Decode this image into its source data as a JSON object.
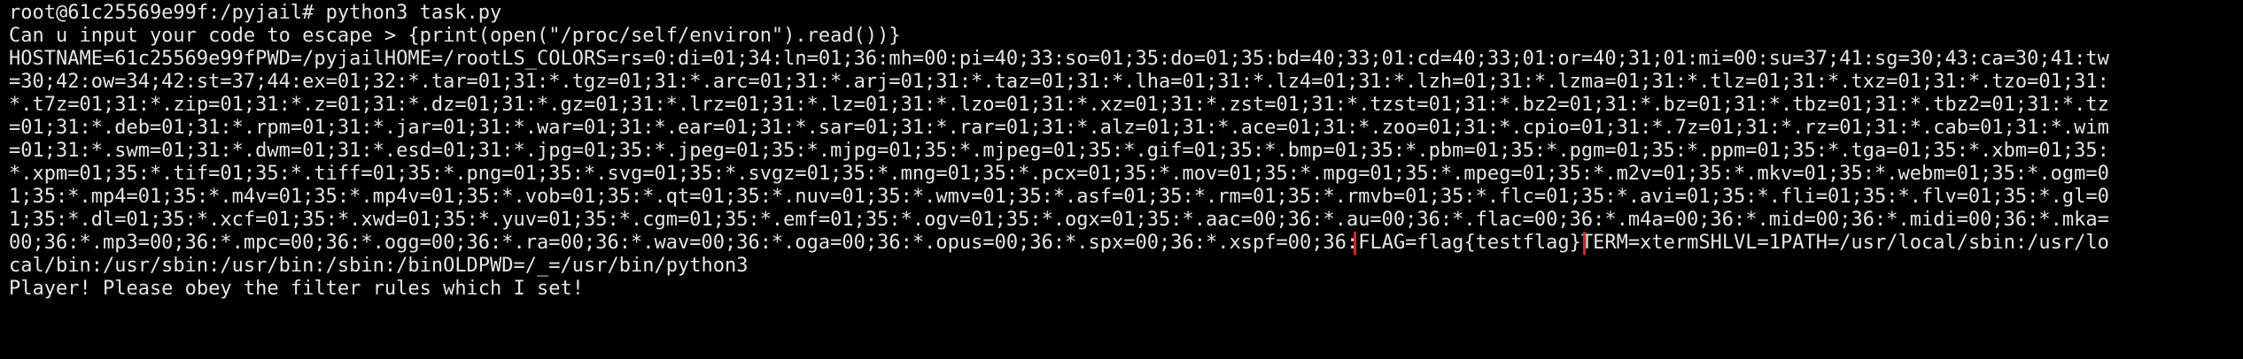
{
  "terminal": {
    "prompt_line": "root@61c25569e99f:/pyjail# python3 task.py",
    "input_line": "Can u input your code to escape > {print(open(\"/proc/self/environ\").read())}",
    "env_lines": [
      "HOSTNAME=61c25569e99fPWD=/pyjailHOME=/rootLS_COLORS=rs=0:di=01;34:ln=01;36:mh=00:pi=40;33:so=01;35:do=01;35:bd=40;33;01:cd=40;33;01:or=40;31;01:mi=00:su=37;41:sg=30;43:ca=30;41:tw",
      "=30;42:ow=34;42:st=37;44:ex=01;32:*.tar=01;31:*.tgz=01;31:*.arc=01;31:*.arj=01;31:*.taz=01;31:*.lha=01;31:*.lz4=01;31:*.lzh=01;31:*.lzma=01;31:*.tlz=01;31:*.txz=01;31:*.tzo=01;31:",
      "*.t7z=01;31:*.zip=01;31:*.z=01;31:*.dz=01;31:*.gz=01;31:*.lrz=01;31:*.lz=01;31:*.lzo=01;31:*.xz=01;31:*.zst=01;31:*.tzst=01;31:*.bz2=01;31:*.bz=01;31:*.tbz=01;31:*.tbz2=01;31:*.tz",
      "=01;31:*.deb=01;31:*.rpm=01;31:*.jar=01;31:*.war=01;31:*.ear=01;31:*.sar=01;31:*.rar=01;31:*.alz=01;31:*.ace=01;31:*.zoo=01;31:*.cpio=01;31:*.7z=01;31:*.rz=01;31:*.cab=01;31:*.wim",
      "=01;31:*.swm=01;31:*.dwm=01;31:*.esd=01;31:*.jpg=01;35:*.jpeg=01;35:*.mjpg=01;35:*.mjpeg=01;35:*.gif=01;35:*.bmp=01;35:*.pbm=01;35:*.pgm=01;35:*.ppm=01;35:*.tga=01;35:*.xbm=01;35:",
      "*.xpm=01;35:*.tif=01;35:*.tiff=01;35:*.png=01;35:*.svg=01;35:*.svgz=01;35:*.mng=01;35:*.pcx=01;35:*.mov=01;35:*.mpg=01;35:*.mpeg=01;35:*.m2v=01;35:*.mkv=01;35:*.webm=01;35:*.ogm=0",
      "1;35:*.mp4=01;35:*.m4v=01;35:*.mp4v=01;35:*.vob=01;35:*.qt=01;35:*.nuv=01;35:*.wmv=01;35:*.asf=01;35:*.rm=01;35:*.rmvb=01;35:*.flc=01;35:*.avi=01;35:*.fli=01;35:*.flv=01;35:*.gl=0",
      "1;35:*.dl=01;35:*.xcf=01;35:*.xwd=01;35:*.yuv=01;35:*.cgm=01;35:*.emf=01;35:*.ogv=01;35:*.ogx=01;35:*.aac=00;36:*.au=00;36:*.flac=00;36:*.m4a=00;36:*.mid=00;36:*.midi=00;36:*.mka="
    ],
    "line9_before": "00;36:*.mp3=00;36:*.mpc=00;36:*.ogg=00;36:*.ra=00;36:*.wav=00;36:*.oga=00;36:*.opus=00;36:*.spx=00;36:*.xspf=00;36:",
    "line9_flag": "FLAG=flag{testflag}",
    "line9_after": "TERM=xtermSHLVL=1PATH=/usr/local/sbin:/usr/lo",
    "line10": "cal/bin:/usr/sbin:/usr/bin:/sbin:/binOLDPWD=/_=/usr/bin/python3",
    "output_line": "Player! Please obey the filter rules which I set!"
  },
  "colors": {
    "background": "#000000",
    "text": "#e6e6e6",
    "highlight": "#e0202a"
  }
}
